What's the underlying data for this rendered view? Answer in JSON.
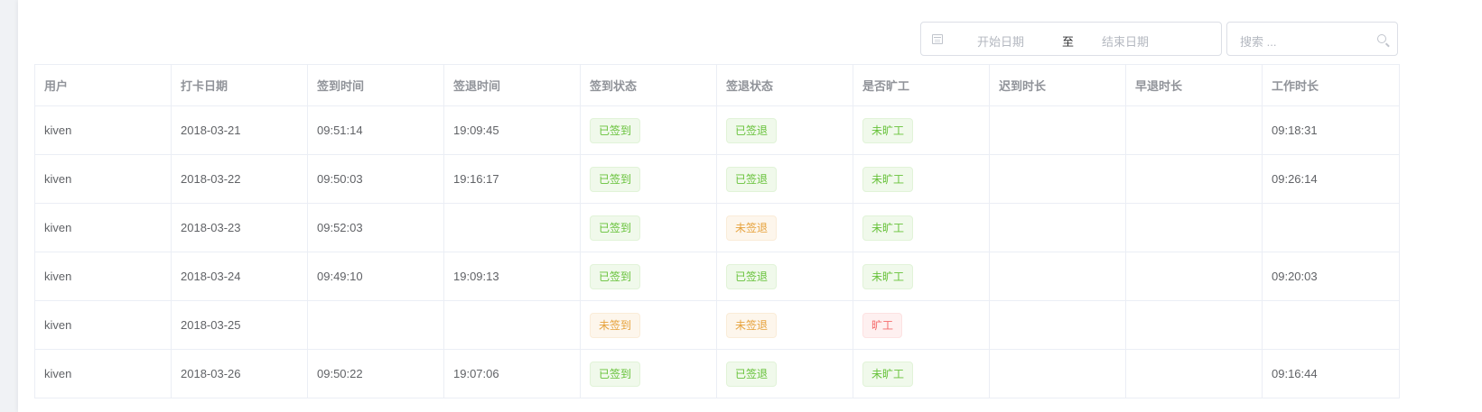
{
  "filters": {
    "start_placeholder": "开始日期",
    "range_separator": "至",
    "end_placeholder": "结束日期",
    "search_placeholder": "搜索 ..."
  },
  "table": {
    "columns": [
      "用户",
      "打卡日期",
      "签到时间",
      "签退时间",
      "签到状态",
      "签退状态",
      "是否旷工",
      "迟到时长",
      "早退时长",
      "工作时长"
    ],
    "rows": [
      {
        "user": "kiven",
        "date": "2018-03-21",
        "sign_in": "09:51:14",
        "sign_out": "19:09:45",
        "in_status": "已签到",
        "out_status": "已签退",
        "absent": "未旷工",
        "late": "",
        "early": "",
        "work": "09:18:31"
      },
      {
        "user": "kiven",
        "date": "2018-03-22",
        "sign_in": "09:50:03",
        "sign_out": "19:16:17",
        "in_status": "已签到",
        "out_status": "已签退",
        "absent": "未旷工",
        "late": "",
        "early": "",
        "work": "09:26:14"
      },
      {
        "user": "kiven",
        "date": "2018-03-23",
        "sign_in": "09:52:03",
        "sign_out": "",
        "in_status": "已签到",
        "out_status": "未签退",
        "absent": "未旷工",
        "late": "",
        "early": "",
        "work": ""
      },
      {
        "user": "kiven",
        "date": "2018-03-24",
        "sign_in": "09:49:10",
        "sign_out": "19:09:13",
        "in_status": "已签到",
        "out_status": "已签退",
        "absent": "未旷工",
        "late": "",
        "early": "",
        "work": "09:20:03"
      },
      {
        "user": "kiven",
        "date": "2018-03-25",
        "sign_in": "",
        "sign_out": "",
        "in_status": "未签到",
        "out_status": "未签退",
        "absent": "旷工",
        "late": "",
        "early": "",
        "work": ""
      },
      {
        "user": "kiven",
        "date": "2018-03-26",
        "sign_in": "09:50:22",
        "sign_out": "19:07:06",
        "in_status": "已签到",
        "out_status": "已签退",
        "absent": "未旷工",
        "late": "",
        "early": "",
        "work": "09:16:44"
      }
    ]
  },
  "tag_types": {
    "已签到": "success",
    "已签退": "success",
    "未旷工": "success",
    "未签到": "warning",
    "未签退": "warning",
    "旷工": "danger"
  },
  "colors": {
    "success": "#67c23a",
    "warning": "#e6a23c",
    "danger": "#f56c6c"
  }
}
